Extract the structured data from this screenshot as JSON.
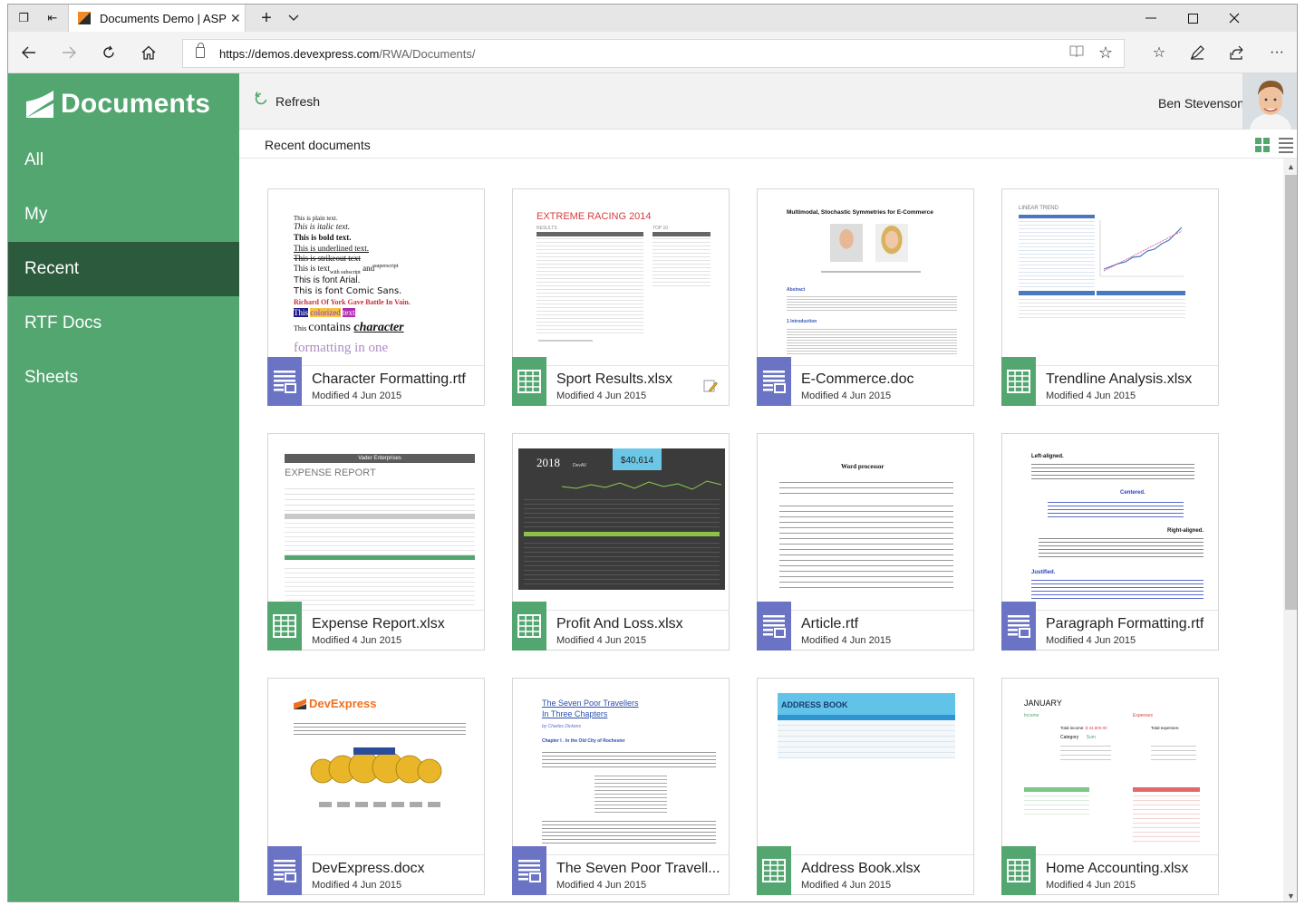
{
  "browser": {
    "tab_title": "Documents Demo | ASP",
    "tab_close": "✕",
    "new_tab": "+",
    "url_host": "https://demos.devexpress.com",
    "url_path": "/RWA/Documents/"
  },
  "app": {
    "brand": "Documents",
    "nav": [
      {
        "label": "All"
      },
      {
        "label": "My"
      },
      {
        "label": "Recent"
      },
      {
        "label": "RTF Docs"
      },
      {
        "label": "Sheets"
      }
    ],
    "toolbar": {
      "refresh_label": "Refresh"
    },
    "user_name": "Ben Stevenson",
    "section_label": "Recent documents"
  },
  "documents": [
    {
      "name": "Character Formatting.rtf",
      "modified": "Modified 4 Jun 2015",
      "type": "doc"
    },
    {
      "name": "Sport Results.xlsx",
      "modified": "Modified 4 Jun 2015",
      "type": "xls"
    },
    {
      "name": "E-Commerce.doc",
      "modified": "Modified 4 Jun 2015",
      "type": "doc"
    },
    {
      "name": "Trendline Analysis.xlsx",
      "modified": "Modified 4 Jun 2015",
      "type": "xls"
    },
    {
      "name": "Expense Report.xlsx",
      "modified": "Modified 4 Jun 2015",
      "type": "xls"
    },
    {
      "name": "Profit And Loss.xlsx",
      "modified": "Modified 4 Jun 2015",
      "type": "xls"
    },
    {
      "name": "Article.rtf",
      "modified": "Modified 4 Jun 2015",
      "type": "doc"
    },
    {
      "name": "Paragraph Formatting.rtf",
      "modified": "Modified 4 Jun 2015",
      "type": "doc"
    },
    {
      "name": "DevExpress.docx",
      "modified": "Modified 4 Jun 2015",
      "type": "doc"
    },
    {
      "name": "The Seven Poor Travell...",
      "modified": "Modified 4 Jun 2015",
      "type": "doc"
    },
    {
      "name": "Address Book.xlsx",
      "modified": "Modified 4 Jun 2015",
      "type": "xls"
    },
    {
      "name": "Home Accounting.xlsx",
      "modified": "Modified 4 Jun 2015",
      "type": "xls"
    }
  ],
  "thumbnails": {
    "char_lines": [
      "This is plain text.",
      "This is italic text.",
      "This is bold text.",
      "This is underlined text.",
      "This is strikeout text",
      "This is text",
      "with subscript",
      "and",
      "superscript",
      "This is font Arial.",
      "This is font Comic Sans.",
      "Richard Of York Gave Battle In Vain.",
      "This",
      "colorized",
      "text",
      "contains",
      "character",
      "formatting in one"
    ],
    "sport_title": "EXTREME RACING 2014",
    "sport_results": "RESULTS",
    "sport_top": "TOP 10",
    "ecom_title": "Multimodal, Stochastic Symmetries for E-Commerce",
    "ecom_abstract": "Abstract",
    "ecom_intro": "1 Introduction",
    "trend_title": "LINEAR TREND",
    "expense_company": "Vader Enterprises",
    "expense_title": "EXPENSE REPORT",
    "pl_year": "2018",
    "pl_sub": "DevAV",
    "pl_amount": "$40,614",
    "article_title": "Word processor",
    "para_left": "Left-aligned.",
    "para_center": "Centered.",
    "para_right": "Right-aligned.",
    "para_just": "Justified.",
    "devx_brand": "DevExpress",
    "travel_title1": "The Seven Poor Travellers",
    "travel_title2": "In Three Chapters",
    "travel_author": "by Charles Dickens",
    "travel_chapter": "Chapter I . In the Old City of Rochester",
    "address_title": "ADDRESS BOOK",
    "home_month": "JANUARY",
    "home_income": "Income",
    "home_expenses": "Expenses",
    "home_total_income": "Total income:",
    "home_total_income_val": "$ 34,800.00",
    "home_total_exp": "Total expenses:",
    "home_cat": "Category",
    "home_sum": "Sum"
  }
}
